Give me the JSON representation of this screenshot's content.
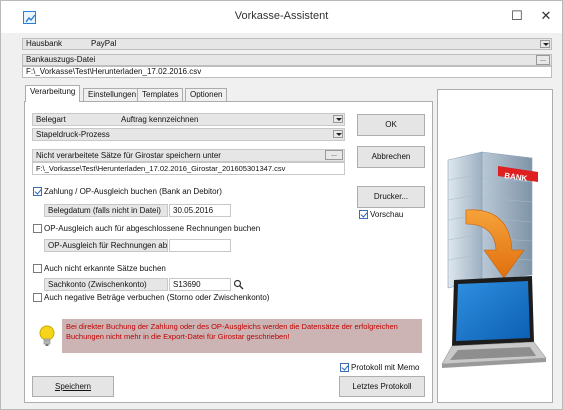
{
  "window": {
    "title": "Vorkasse-Assistent",
    "minimize_glyph": "☐",
    "close_glyph": "✕"
  },
  "hausbank": {
    "label": "Hausbank",
    "value": "PayPal"
  },
  "bankauszug": {
    "label": "Bankauszugs-Datei",
    "path": "F:\\_Vorkasse\\Test\\Herunterladen_17.02.2016.csv",
    "browse_label": "..."
  },
  "tabs": [
    {
      "label": "Verarbeitung"
    },
    {
      "label": "Einstellungen"
    },
    {
      "label": "Templates"
    },
    {
      "label": "Optionen"
    }
  ],
  "belegart": {
    "label": "Belegart",
    "value": "Auftrag kennzeichnen"
  },
  "stapeldruck": {
    "label": "Stapeldruck-Prozess",
    "value": ""
  },
  "unprocessed": {
    "label": "Nicht verarbeitete Sätze für Girostar speichern unter",
    "path": "F:\\_Vorkasse\\Test\\Herunterladen_17.02.2016_Girostar_201605301347.csv",
    "browse_label": "..."
  },
  "zahlung": {
    "label": "Zahlung / OP-Ausgleich buchen (Bank an Debitor)",
    "checked": true
  },
  "belegdatum": {
    "label": "Belegdatum (falls nicht in Datei)",
    "value": "30.05.2016"
  },
  "op_closed": {
    "label": "OP-Ausgleich auch für abgeschlossene Rechnungen buchen",
    "checked": false
  },
  "op_ab": {
    "label": "OP-Ausgleich für Rechnungen ab",
    "value": ""
  },
  "unknown": {
    "label": "Auch nicht erkannte Sätze buchen",
    "checked": false
  },
  "sachkonto": {
    "label": "Sachkonto (Zwischenkonto)",
    "value": "S13690"
  },
  "negative": {
    "label": "Auch negative Beträge verbuchen (Storno oder Zwischenkonto)",
    "checked": false
  },
  "warning": {
    "text": "Bei direkter Buchung der Zahlung oder des OP-Ausgleichs werden die Datensätze der erfolgreichen Buchungen nicht mehr in die Export-Datei für Girostar geschrieben!"
  },
  "protokoll_memo": {
    "label": "Protokoll mit Memo",
    "checked": true
  },
  "buttons": {
    "ok": "OK",
    "cancel": "Abbrechen",
    "printer": "Drucker...",
    "save": "Speichern",
    "last_log": "Letztes Protokoll"
  },
  "vorschau": {
    "label": "Vorschau",
    "checked": true
  },
  "illustration": {
    "bank_sign": "BANK"
  },
  "colors": {
    "warning_bg": "#ccb4b4",
    "warning_text": "#c00000",
    "accent": "#2b5fbf"
  }
}
